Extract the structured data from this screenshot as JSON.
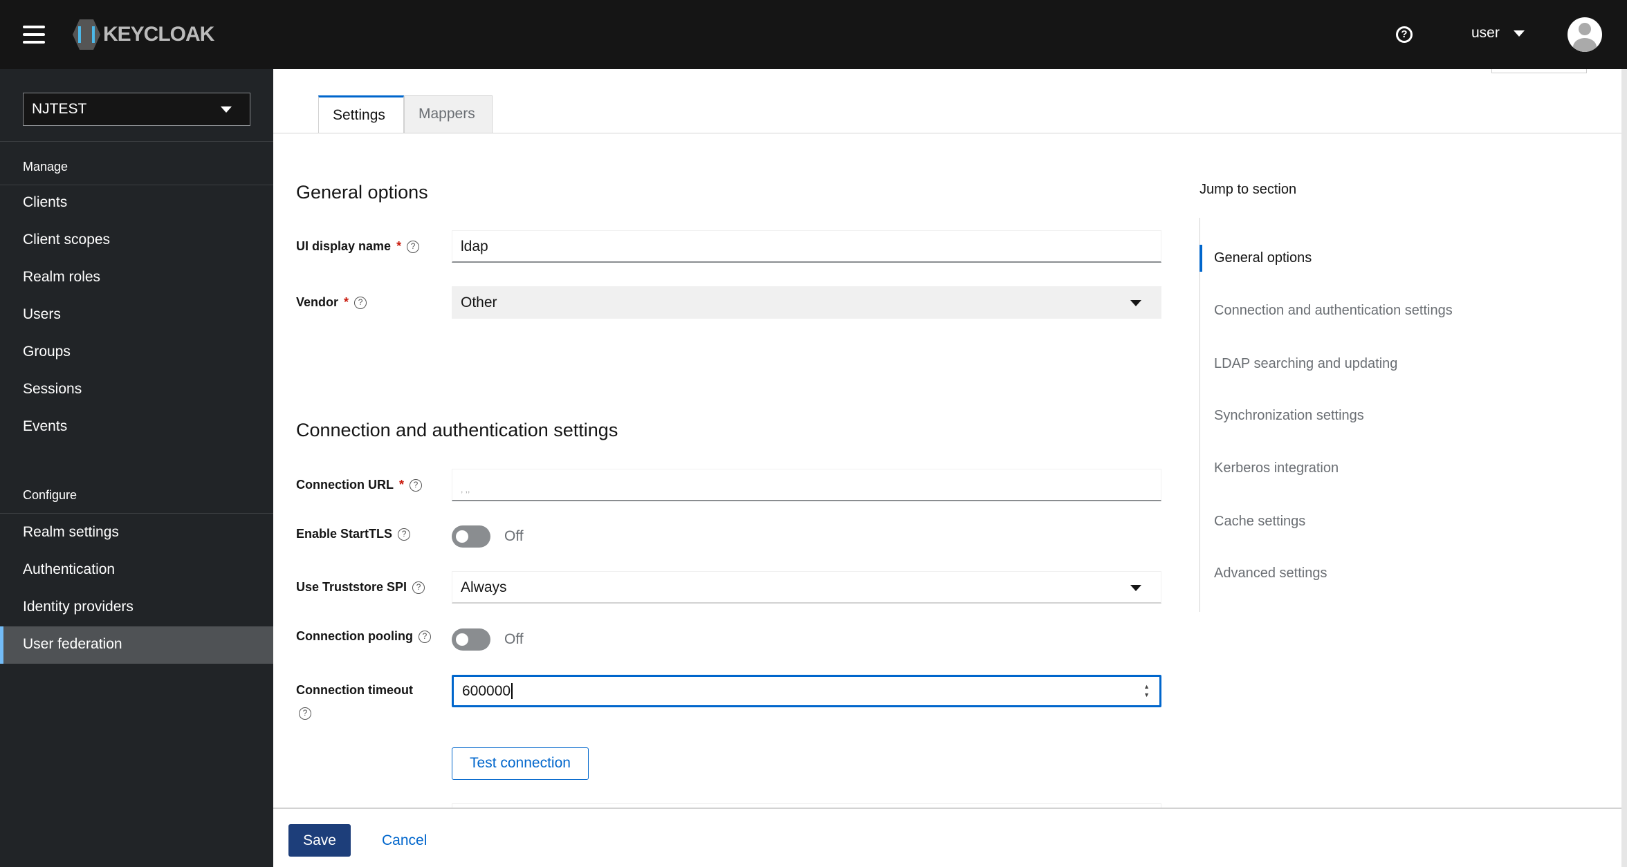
{
  "header": {
    "brand": "KEYCLOAK",
    "user": "user"
  },
  "sidebar": {
    "realm": "NJTEST",
    "manage_label": "Manage",
    "manage": [
      "Clients",
      "Client scopes",
      "Realm roles",
      "Users",
      "Groups",
      "Sessions",
      "Events"
    ],
    "configure_label": "Configure",
    "configure": [
      "Realm settings",
      "Authentication",
      "Identity providers",
      "User federation"
    ],
    "active": "User federation"
  },
  "tabs": [
    "Settings",
    "Mappers"
  ],
  "form": {
    "general_title": "General options",
    "ui_display_name_label": "UI display name",
    "ui_display_name": "ldap",
    "vendor_label": "Vendor",
    "vendor": "Other",
    "conn_title": "Connection and authentication settings",
    "conn_url_label": "Connection URL",
    "conn_url": ", ,,",
    "starttls_label": "Enable StartTLS",
    "starttls": "Off",
    "truststore_label": "Use Truststore SPI",
    "truststore": "Always",
    "pooling_label": "Connection pooling",
    "pooling": "Off",
    "timeout_label": "Connection timeout",
    "timeout": "600000",
    "test_connection": "Test connection",
    "required_mark": "*"
  },
  "jump": {
    "title": "Jump to section",
    "items": [
      "General options",
      "Connection and authentication settings",
      "LDAP searching and updating",
      "Synchronization settings",
      "Kerberos integration",
      "Cache settings",
      "Advanced settings"
    ]
  },
  "footer": {
    "save": "Save",
    "cancel": "Cancel"
  },
  "colors": {
    "accent": "#0066cc",
    "primary_button": "#1d3e7a",
    "header": "#151515",
    "sidebar": "#212427"
  }
}
